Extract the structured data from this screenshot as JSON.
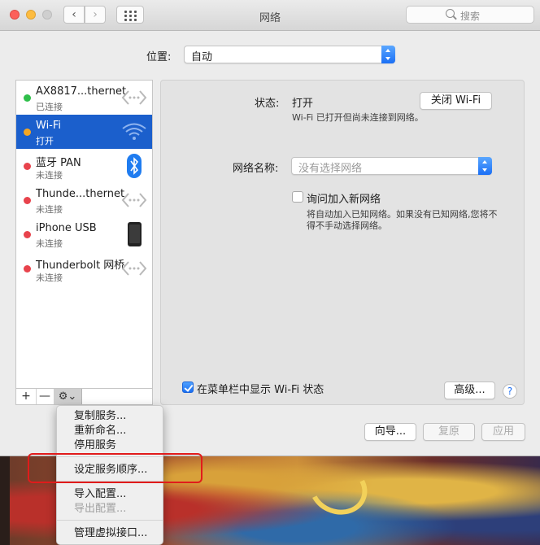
{
  "window": {
    "title": "网络",
    "search_placeholder": "搜索"
  },
  "location": {
    "label": "位置:",
    "value": "自动"
  },
  "services": [
    {
      "name": "AX8817...thernet",
      "status": "已连接",
      "dot": "#2fbf4a",
      "icon": "ethernet-arrows-icon"
    },
    {
      "name": "Wi-Fi",
      "status": "打开",
      "dot": "#f5a623",
      "icon": "wifi-icon",
      "selected": true
    },
    {
      "name": "蓝牙 PAN",
      "status": "未连接",
      "dot": "#e8434c",
      "icon": "bluetooth-icon"
    },
    {
      "name": "Thunde...thernet",
      "status": "未连接",
      "dot": "#e8434c",
      "icon": "ethernet-arrows-icon"
    },
    {
      "name": "iPhone USB",
      "status": "未连接",
      "dot": "#e8434c",
      "icon": "iphone-icon"
    },
    {
      "name": "Thunderbolt 网桥",
      "status": "未连接",
      "dot": "#e8434c",
      "icon": "ethernet-arrows-icon"
    }
  ],
  "toolbar": {
    "add": "+",
    "remove": "—",
    "gear": "⚙︎⌄"
  },
  "detail": {
    "status_label": "状态:",
    "status_value": "打开",
    "turn_off_button": "关闭 Wi-Fi",
    "status_desc": "Wi-Fi 已打开但尚未连接到网络。",
    "network_name_label": "网络名称:",
    "network_name_placeholder": "没有选择网络",
    "ask_join_label": "询问加入新网络",
    "ask_join_desc_1": "将自动加入已知网络。如果没有已知网络,您将不",
    "ask_join_desc_2": "得不手动选择网络。",
    "show_menubar_label": "在菜单栏中显示 Wi-Fi 状态",
    "advanced_button": "高级...",
    "help": "?"
  },
  "footer": {
    "assistant": "向导...",
    "revert": "复原",
    "apply": "应用"
  },
  "context_menu": {
    "items": [
      "复制服务...",
      "重新命名...",
      "停用服务",
      "设定服务顺序...",
      "导入配置...",
      "导出配置...",
      "管理虚拟接口..."
    ]
  },
  "colors": {
    "selection": "#1b5fcc",
    "accent": "#1b6ff5",
    "highlight_box": "#e11b1b"
  }
}
